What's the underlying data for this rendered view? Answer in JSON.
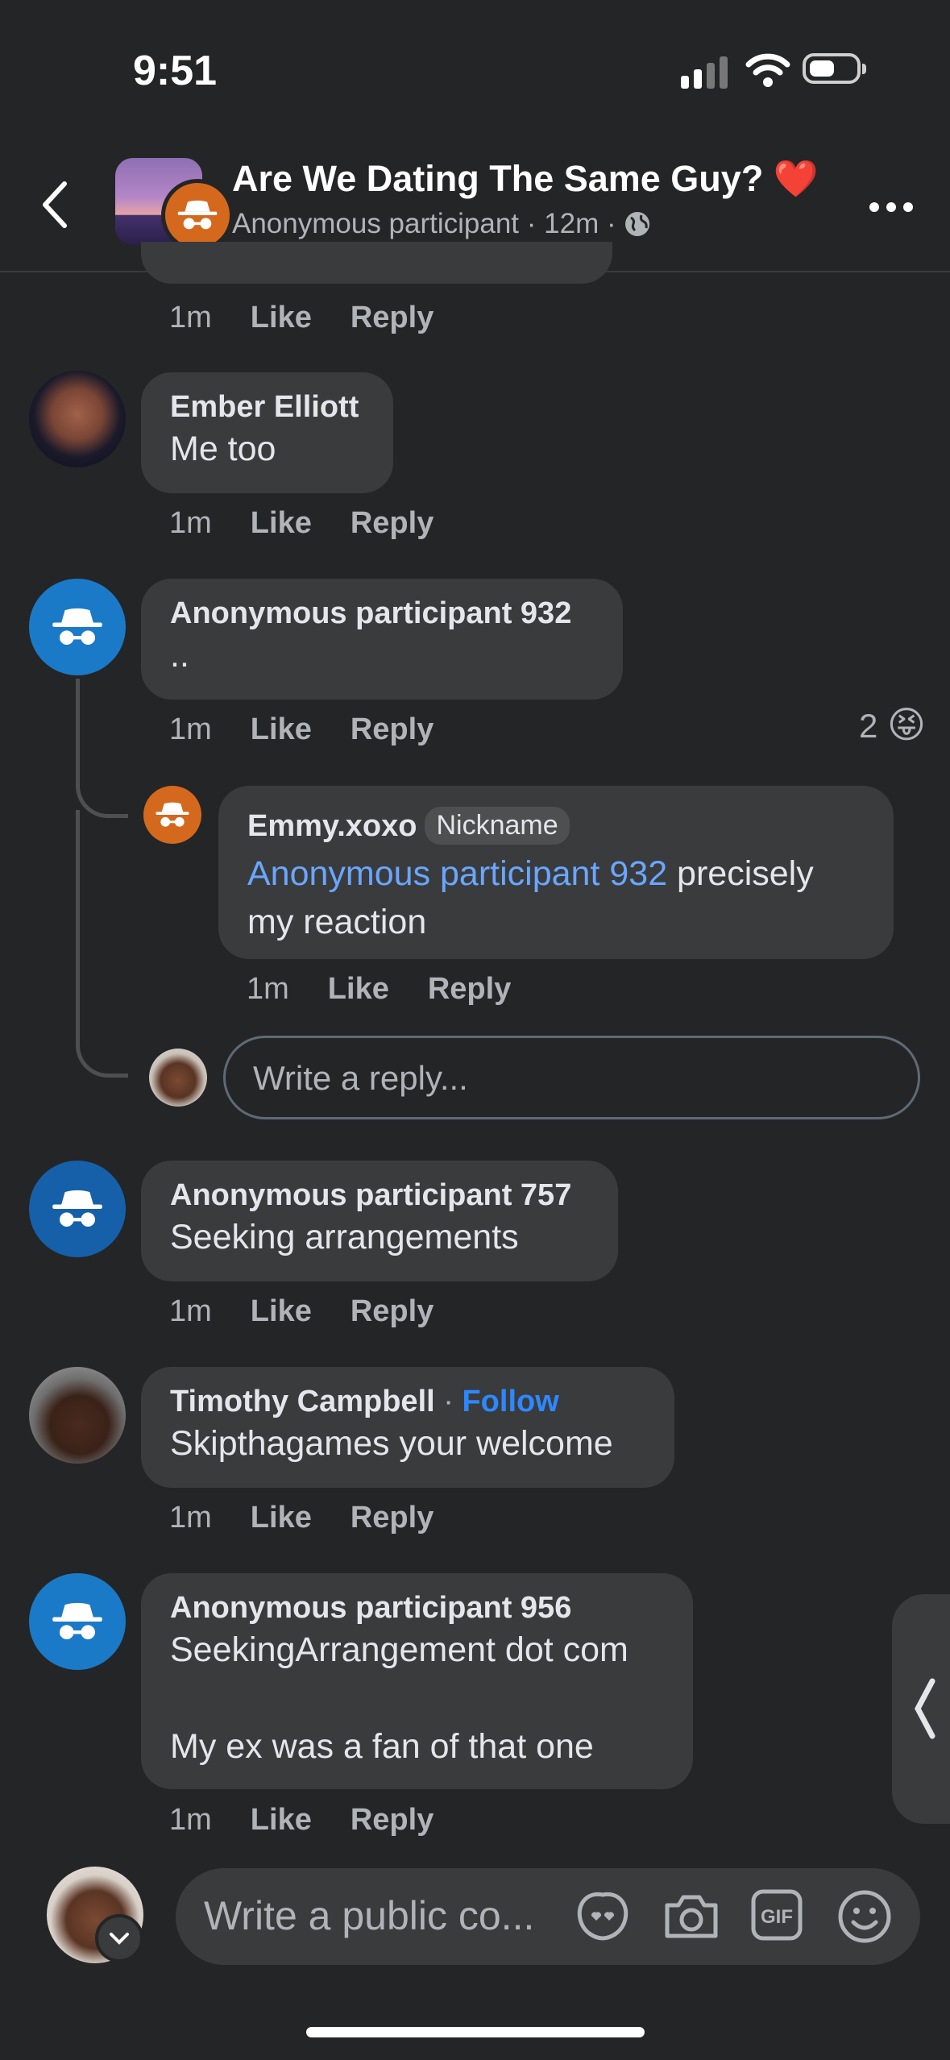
{
  "status_bar": {
    "time": "9:51"
  },
  "header": {
    "title": "Are We Dating The Same Guy? ❤️",
    "subtitle_author": "Anonymous participant",
    "subtitle_time": "12m",
    "separator": "·"
  },
  "comments": [
    {
      "time": "1m",
      "like": "Like",
      "reply": "Reply"
    },
    {
      "author": "Ember Elliott",
      "text": "Me too",
      "time": "1m",
      "like": "Like",
      "reply": "Reply"
    },
    {
      "author": "Anonymous participant 932",
      "text": "..",
      "time": "1m",
      "like": "Like",
      "reply": "Reply",
      "reaction_count": "2",
      "reaction_emoji": "😝",
      "replies": [
        {
          "author": "Emmy.xoxo",
          "badge": "Nickname",
          "mention": "Anonymous participant 932",
          "text_line1": " precisely",
          "text_line2": "my reaction",
          "time": "1m",
          "like": "Like",
          "reply": "Reply"
        }
      ],
      "reply_placeholder": "Write a reply..."
    },
    {
      "author": "Anonymous participant 757",
      "text": "Seeking arrangements",
      "time": "1m",
      "like": "Like",
      "reply": "Reply"
    },
    {
      "author": "Timothy Campbell",
      "follow": "Follow",
      "text": "Skipthagames your welcome",
      "time": "1m",
      "like": "Like",
      "reply": "Reply"
    },
    {
      "author": "Anonymous participant 956",
      "text_line1": "SeekingArrangement dot com",
      "text_line2": "My ex was a fan of that one",
      "time": "1m",
      "like": "Like",
      "reply": "Reply"
    }
  ],
  "composer": {
    "placeholder": "Write a public co..."
  },
  "colors": {
    "background": "#242526",
    "bubble": "#3a3b3c",
    "link": "#2d88ff",
    "anon_avatar": "#1a7ac8"
  }
}
